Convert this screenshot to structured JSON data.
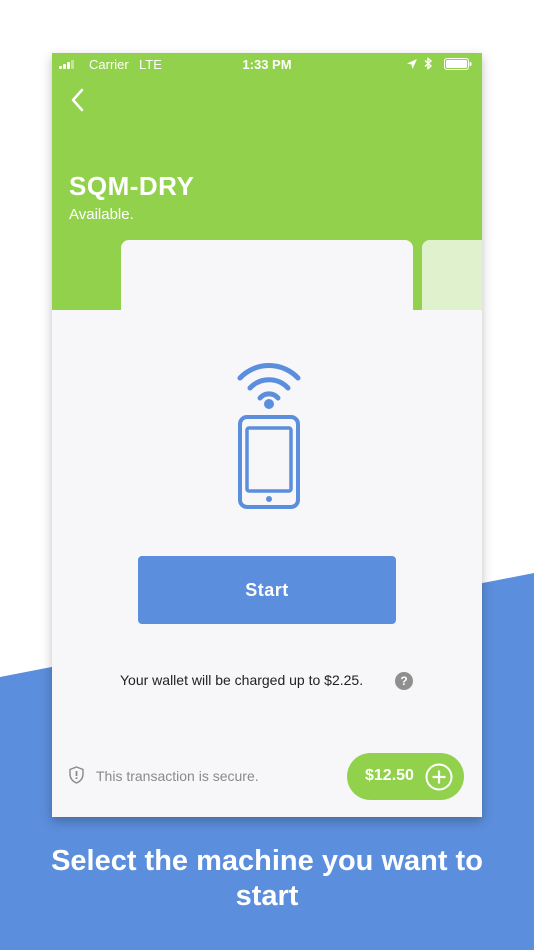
{
  "colors": {
    "accent": "#92d14b",
    "primary": "#5b8edc",
    "background_band": "#5b8edc"
  },
  "status_bar": {
    "carrier": "Carrier",
    "network": "LTE",
    "time": "1:33 PM",
    "icons": [
      "signal-icon",
      "location-arrow-icon",
      "bluetooth-icon",
      "battery-icon"
    ]
  },
  "header": {
    "back_icon": "chevron-left-icon",
    "machine_name": "SQM-DRY",
    "machine_status": "Available."
  },
  "card": {
    "icon": "phone-nfc-icon",
    "start_label": "Start"
  },
  "charge_note": "Your wallet will be charged up to $2.25.",
  "help_label": "?",
  "footer": {
    "secure_text": "This transaction is secure.",
    "wallet_amount": "$12.50",
    "add_icon": "plus-circle-icon"
  },
  "caption": "Select the machine you want to start"
}
